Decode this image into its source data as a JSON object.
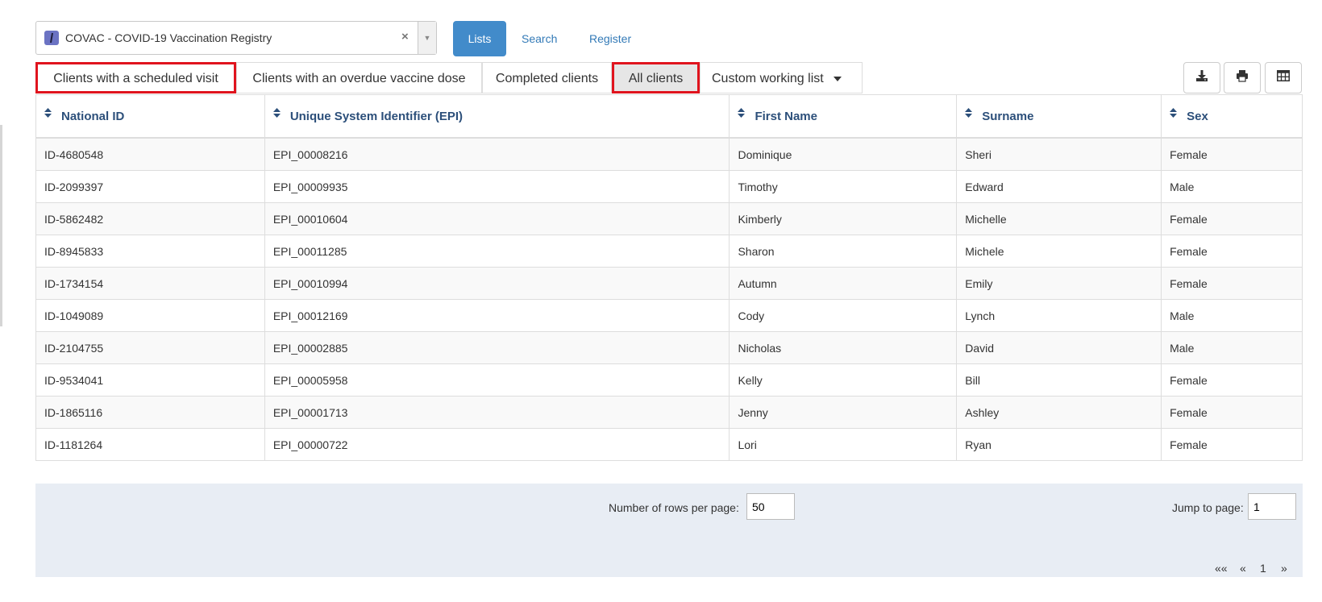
{
  "program": {
    "selected": "COVAC - COVID-19 Vaccination Registry",
    "clear_symbol": "×",
    "icon": "syringe-icon"
  },
  "nav": {
    "lists": "Lists",
    "search": "Search",
    "register": "Register"
  },
  "tabs": {
    "scheduled": "Clients with a scheduled visit",
    "overdue": "Clients with an overdue vaccine dose",
    "completed": "Completed clients",
    "all": "All clients",
    "custom": "Custom working list"
  },
  "toolbar": {
    "download_icon": "download-icon",
    "print_icon": "print-icon",
    "columns_icon": "table-columns-icon"
  },
  "table": {
    "headers": [
      "National ID",
      "Unique System Identifier (EPI)",
      "First Name",
      "Surname",
      "Sex"
    ],
    "rows": [
      [
        "ID-4680548",
        "EPI_00008216",
        "Dominique",
        "Sheri",
        "Female"
      ],
      [
        "ID-2099397",
        "EPI_00009935",
        "Timothy",
        "Edward",
        "Male"
      ],
      [
        "ID-5862482",
        "EPI_00010604",
        "Kimberly",
        "Michelle",
        "Female"
      ],
      [
        "ID-8945833",
        "EPI_00011285",
        "Sharon",
        "Michele",
        "Female"
      ],
      [
        "ID-1734154",
        "EPI_00010994",
        "Autumn",
        "Emily",
        "Female"
      ],
      [
        "ID-1049089",
        "EPI_00012169",
        "Cody",
        "Lynch",
        "Male"
      ],
      [
        "ID-2104755",
        "EPI_00002885",
        "Nicholas",
        "David",
        "Male"
      ],
      [
        "ID-9534041",
        "EPI_00005958",
        "Kelly",
        "Bill",
        "Female"
      ],
      [
        "ID-1865116",
        "EPI_00001713",
        "Jenny",
        "Ashley",
        "Female"
      ],
      [
        "ID-1181264",
        "EPI_00000722",
        "Lori",
        "Ryan",
        "Female"
      ]
    ]
  },
  "pager": {
    "rows_label": "Number of rows per page:",
    "rows_value": "50",
    "jump_label": "Jump to page:",
    "jump_value": "1",
    "first": "««",
    "prev": "«",
    "current": "1",
    "next": "»"
  },
  "colors": {
    "accent": "#428bca",
    "link": "#337ab7",
    "header_text": "#2c4f7a",
    "highlight_box": "#e0141e",
    "pager_bg": "#e8edf4"
  }
}
